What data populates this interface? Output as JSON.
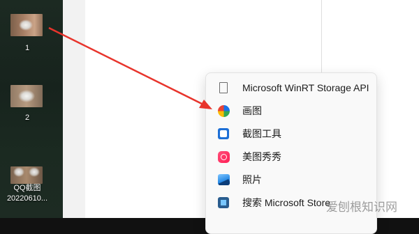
{
  "desktop": {
    "icons": [
      {
        "label": "1"
      },
      {
        "label": "2"
      },
      {
        "label_line1": "QQ截图",
        "label_line2": "20220610..."
      }
    ]
  },
  "context_menu": {
    "items": [
      {
        "label": "Microsoft WinRT Storage API",
        "icon": "document-icon"
      },
      {
        "label": "画图",
        "icon": "paint-icon"
      },
      {
        "label": "截图工具",
        "icon": "snipping-tool-icon"
      },
      {
        "label": "美图秀秀",
        "icon": "meitu-icon"
      },
      {
        "label": "照片",
        "icon": "photos-icon"
      },
      {
        "label": "搜索 Microsoft Store",
        "icon": "microsoft-store-icon"
      }
    ]
  },
  "annotation": {
    "color": "#e8342c"
  },
  "watermark": {
    "text": "爱刨根知识网"
  }
}
